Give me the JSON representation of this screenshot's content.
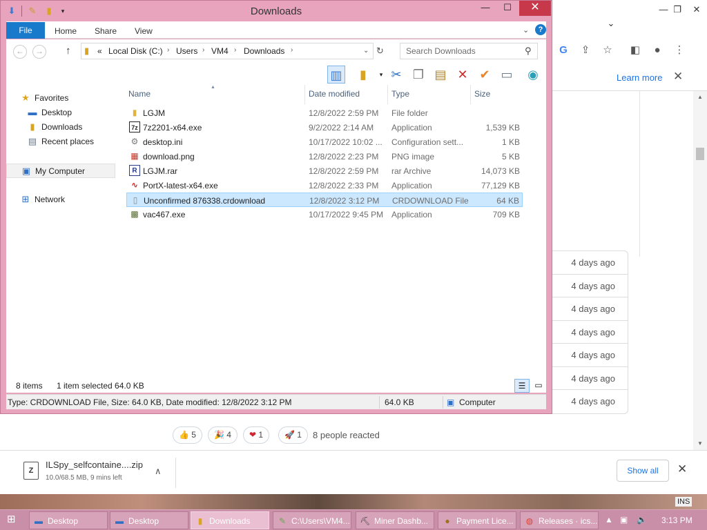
{
  "explorer": {
    "title": "Downloads",
    "ribbon_tabs": [
      "File",
      "Home",
      "Share",
      "View"
    ],
    "breadcrumb": [
      "«",
      "Local Disk (C:)",
      "Users",
      "VM4",
      "Downloads"
    ],
    "search_placeholder": "Search Downloads",
    "nav_pane": {
      "favorites": "Favorites",
      "desktop": "Desktop",
      "downloads": "Downloads",
      "recent": "Recent places",
      "computer": "My Computer",
      "network": "Network"
    },
    "columns": {
      "name": "Name",
      "date": "Date modified",
      "type": "Type",
      "size": "Size"
    },
    "files": [
      {
        "name": "LGJM",
        "date": "12/8/2022 2:59 PM",
        "type": "File folder",
        "size": "",
        "icon": "folder-icon"
      },
      {
        "name": "7z2201-x64.exe",
        "date": "9/2/2022 2:14 AM",
        "type": "Application",
        "size": "1,539 KB",
        "icon": "7zip-icon"
      },
      {
        "name": "desktop.ini",
        "date": "10/17/2022 10:02 ...",
        "type": "Configuration sett...",
        "size": "1 KB",
        "icon": "settings-file-icon"
      },
      {
        "name": "download.png",
        "date": "12/8/2022 2:23 PM",
        "type": "PNG image",
        "size": "5 KB",
        "icon": "image-file-icon"
      },
      {
        "name": "LGJM.rar",
        "date": "12/8/2022 2:59 PM",
        "type": "rar Archive",
        "size": "14,073 KB",
        "icon": "rar-archive-icon"
      },
      {
        "name": "PortX-latest-x64.exe",
        "date": "12/8/2022 2:33 PM",
        "type": "Application",
        "size": "77,129 KB",
        "icon": "portx-app-icon"
      },
      {
        "name": "Unconfirmed 876338.crdownload",
        "date": "12/8/2022 3:12 PM",
        "type": "CRDOWNLOAD File",
        "size": "64 KB",
        "icon": "blank-file-icon"
      },
      {
        "name": "vac467.exe",
        "date": "10/17/2022 9:45 PM",
        "type": "Application",
        "size": "709 KB",
        "icon": "exe-app-icon"
      }
    ],
    "status": {
      "item_count": "8 items",
      "selection": "1 item selected  64.0 KB",
      "details": "Type: CRDOWNLOAD File, Size: 64.0 KB, Date modified: 12/8/2022 3:12 PM",
      "size": "64.0 KB",
      "location": "Computer"
    }
  },
  "browser": {
    "learn_more": "Learn more",
    "release_times": [
      "4 days ago",
      "4 days ago",
      "4 days ago",
      "4 days ago",
      "4 days ago",
      "4 days ago",
      "4 days ago"
    ],
    "reactions": [
      {
        "emoji": "👍",
        "count": "5"
      },
      {
        "emoji": "🎉",
        "count": "4"
      },
      {
        "emoji": "❤",
        "count": "1"
      },
      {
        "emoji": "🚀",
        "count": "1"
      }
    ],
    "reaction_summary": "8 people reacted",
    "download": {
      "name": "ILSpy_selfcontaine....zip",
      "status": "10.0/68.5 MB, 9 mins left"
    },
    "show_all": "Show all",
    "ins": "INS"
  },
  "taskbar": {
    "items": [
      "Desktop",
      "Desktop",
      "Downloads",
      "C:\\Users\\VM4...",
      "Miner Dashb...",
      "Payment Lice...",
      "Releases · ics..."
    ],
    "time": "3:13 PM"
  },
  "colors": {
    "window_frame": "#e8a4bc",
    "selection": "#cce8ff",
    "file_tab": "#1979ca",
    "taskbar": "#c98fa8"
  }
}
